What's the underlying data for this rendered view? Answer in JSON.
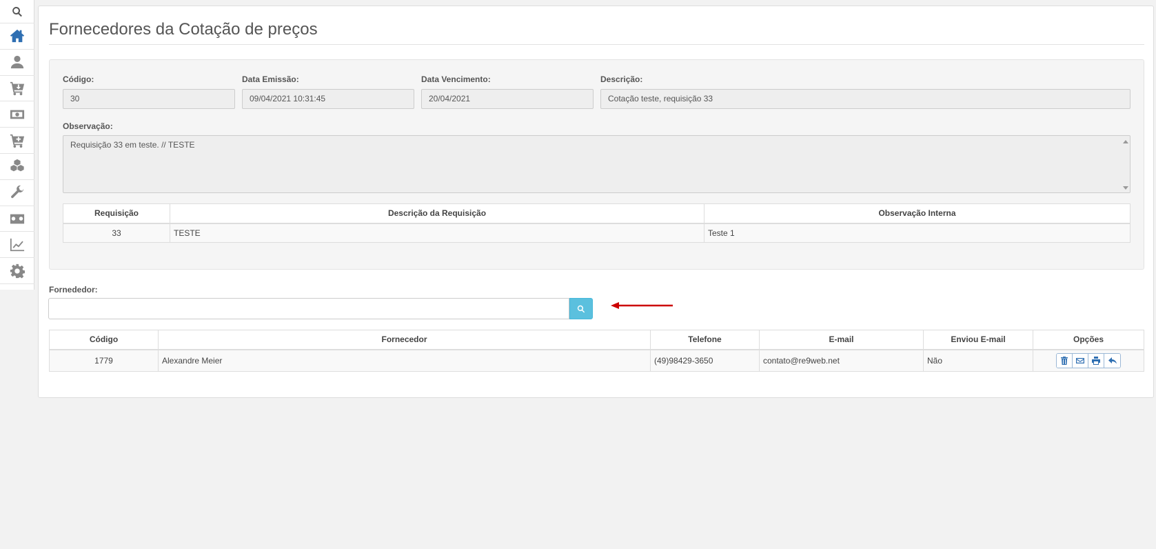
{
  "sidebar": {
    "items": [
      {
        "icon": "search-icon"
      },
      {
        "icon": "home-icon",
        "active": true
      },
      {
        "icon": "user-icon"
      },
      {
        "icon": "cart-down-icon"
      },
      {
        "icon": "money-icon"
      },
      {
        "icon": "cart-plus-icon"
      },
      {
        "icon": "cubes-icon"
      },
      {
        "icon": "wrench-icon"
      },
      {
        "icon": "cassette-icon"
      },
      {
        "icon": "chart-line-icon"
      },
      {
        "icon": "gear-icon"
      }
    ]
  },
  "page": {
    "title": "Fornecedores da Cotação de preços"
  },
  "quote": {
    "codigo_label": "Código:",
    "codigo_value": "30",
    "data_emissao_label": "Data Emissão:",
    "data_emissao_value": "09/04/2021 10:31:45",
    "data_vencimento_label": "Data Vencimento:",
    "data_vencimento_value": "20/04/2021",
    "descricao_label": "Descrição:",
    "descricao_value": "Cotação teste, requisição 33",
    "observacao_label": "Observação:",
    "observacao_value": "Requisição 33 em teste. // TESTE"
  },
  "requisitions": {
    "headers": [
      "Requisição",
      "Descrição da Requisição",
      "Observação Interna"
    ],
    "rows": [
      [
        "33",
        "TESTE",
        "Teste 1"
      ]
    ]
  },
  "supplier_search": {
    "label": "Fornededor:",
    "value": "",
    "placeholder": ""
  },
  "suppliers": {
    "headers": [
      "Código",
      "Fornecedor",
      "Telefone",
      "E-mail",
      "Enviou E-mail",
      "Opções"
    ],
    "rows": [
      [
        "1779",
        "Alexandre Meier",
        "(49)98429-3650",
        "contato@re9web.net",
        "Não"
      ]
    ]
  },
  "colors": {
    "accent": "#2f6fb2",
    "search_button": "#5bc0de",
    "annotation_arrow": "#cc0000"
  }
}
